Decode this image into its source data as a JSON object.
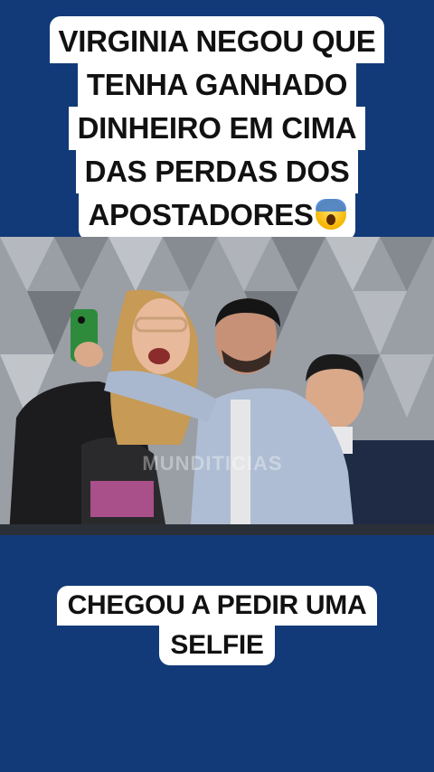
{
  "top_caption": {
    "lines": [
      "VIRGINIA NEGOU QUE",
      "TENHA GANHADO",
      "DINHEIRO EM CIMA",
      "DAS PERDAS DOS",
      "APOSTADORES"
    ],
    "emoji": "face-screaming-in-fear-icon"
  },
  "watermark": "MUNDITICIAS",
  "bottom_caption": {
    "lines": [
      "CHEGOU A PEDIR UMA",
      "SELFIE"
    ]
  },
  "colors": {
    "background": "#123a78",
    "caption_bg": "#ffffff",
    "caption_text": "#111111"
  }
}
